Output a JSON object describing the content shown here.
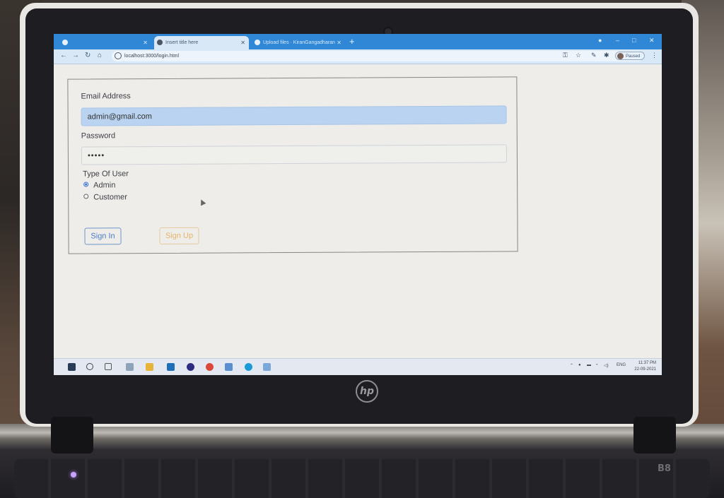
{
  "browser": {
    "tabs": [
      {
        "title": "",
        "active": false
      },
      {
        "title": "Insert title here",
        "active": true
      },
      {
        "title": "Upload files · KiranGangadharan",
        "active": false
      }
    ],
    "new_tab": "+",
    "address_url": "localhost:3000/login.html",
    "profile_label": "Paused",
    "window_controls": {
      "minimize": "–",
      "maximize": "□",
      "close": "✕"
    }
  },
  "form": {
    "email_label": "Email Address",
    "email_value": "admin@gmail.com",
    "password_label": "Password",
    "password_value": "•••••",
    "user_type_label": "Type Of User",
    "options": [
      {
        "label": "Admin",
        "checked": true
      },
      {
        "label": "Customer",
        "checked": false
      }
    ],
    "sign_in_label": "Sign In",
    "sign_up_label": "Sign Up"
  },
  "taskbar": {
    "language": "ENG",
    "time": "11:37 PM",
    "date": "22-09-2021"
  },
  "laptop": {
    "model_badge": "B8"
  },
  "colors": {
    "browser_accent": "#2f87d6",
    "autofill_bg": "#b9d3f0",
    "sign_in": "#4a7cc4",
    "sign_up": "#e6b46a"
  }
}
